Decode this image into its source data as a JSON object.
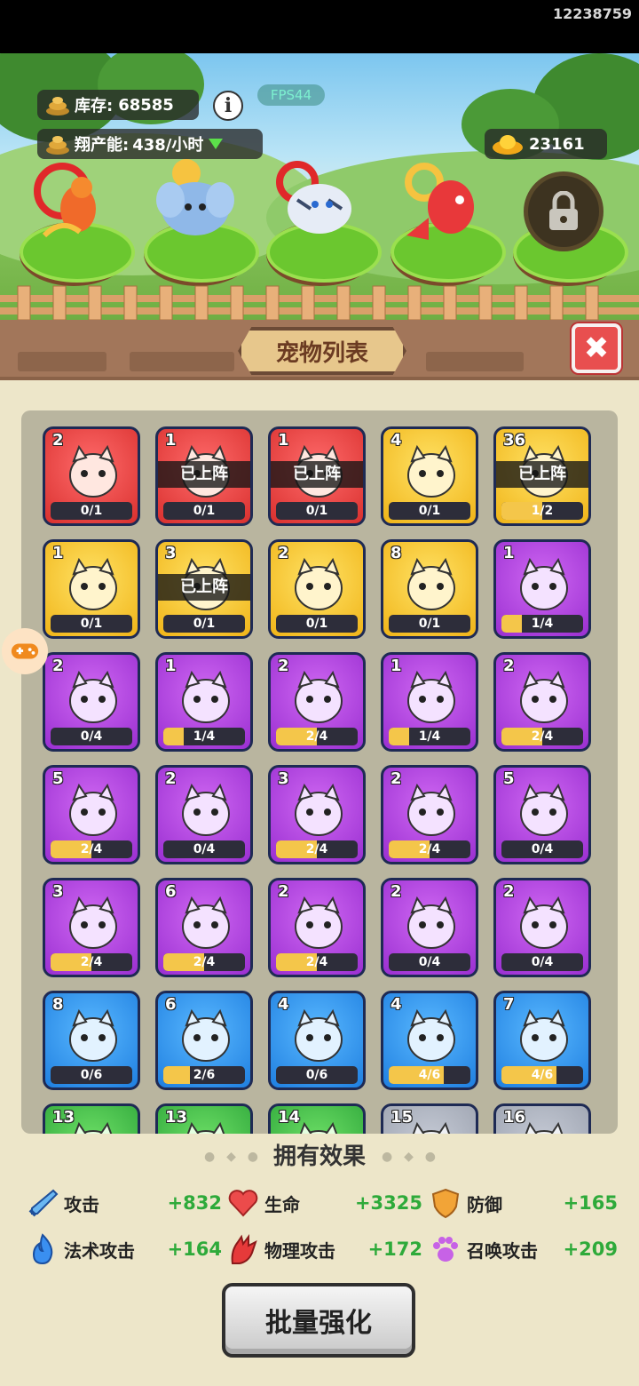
{
  "status": {
    "device_id": "12238759"
  },
  "hud": {
    "stock_label": "库存:",
    "stock_value": "68585",
    "production_label": "翔产能:",
    "production_value": "438/小时",
    "fps": "FPS44",
    "gold": "23161"
  },
  "panel": {
    "title": "宠物列表",
    "close": "✖"
  },
  "deployed_text": "已上阵",
  "pets": [
    {
      "level": "2",
      "frac": "0/1",
      "progress": 0,
      "rarity": "red",
      "deployed": false,
      "icon": "bird-icon"
    },
    {
      "level": "1",
      "frac": "0/1",
      "progress": 0,
      "rarity": "red",
      "deployed": true,
      "icon": "phoenix-icon"
    },
    {
      "level": "1",
      "frac": "0/1",
      "progress": 0,
      "rarity": "red",
      "deployed": true,
      "icon": "tiger-icon"
    },
    {
      "level": "4",
      "frac": "0/1",
      "progress": 0,
      "rarity": "yellow",
      "deployed": false,
      "icon": "fox-icon"
    },
    {
      "level": "36",
      "frac": "1/2",
      "progress": 0.5,
      "rarity": "yellow",
      "deployed": true,
      "icon": "dragon-icon"
    },
    {
      "level": "1",
      "frac": "0/1",
      "progress": 0,
      "rarity": "yellow",
      "deployed": false,
      "icon": "panda-icon"
    },
    {
      "level": "3",
      "frac": "0/1",
      "progress": 0,
      "rarity": "yellow",
      "deployed": true,
      "icon": "goldfish-icon"
    },
    {
      "level": "2",
      "frac": "0/1",
      "progress": 0,
      "rarity": "yellow",
      "deployed": false,
      "icon": "unicorn-icon"
    },
    {
      "level": "8",
      "frac": "0/1",
      "progress": 0,
      "rarity": "yellow",
      "deployed": false,
      "icon": "lion-icon"
    },
    {
      "level": "1",
      "frac": "1/4",
      "progress": 0.25,
      "rarity": "purple",
      "deployed": false,
      "icon": "frog-icon"
    },
    {
      "level": "2",
      "frac": "0/4",
      "progress": 0,
      "rarity": "purple",
      "deployed": false,
      "icon": "goat-icon"
    },
    {
      "level": "1",
      "frac": "1/4",
      "progress": 0.25,
      "rarity": "purple",
      "deployed": false,
      "icon": "monkey-icon"
    },
    {
      "level": "2",
      "frac": "2/4",
      "progress": 0.5,
      "rarity": "purple",
      "deployed": false,
      "icon": "sheep-icon"
    },
    {
      "level": "1",
      "frac": "1/4",
      "progress": 0.25,
      "rarity": "purple",
      "deployed": false,
      "icon": "leopard-icon"
    },
    {
      "level": "2",
      "frac": "2/4",
      "progress": 0.5,
      "rarity": "purple",
      "deployed": false,
      "icon": "hamster-icon"
    },
    {
      "level": "5",
      "frac": "2/4",
      "progress": 0.5,
      "rarity": "purple",
      "deployed": false,
      "icon": "octopus-icon"
    },
    {
      "level": "2",
      "frac": "0/4",
      "progress": 0,
      "rarity": "purple",
      "deployed": false,
      "icon": "wolf-icon"
    },
    {
      "level": "3",
      "frac": "2/4",
      "progress": 0.5,
      "rarity": "purple",
      "deployed": false,
      "icon": "cat-icon"
    },
    {
      "level": "2",
      "frac": "2/4",
      "progress": 0.5,
      "rarity": "purple",
      "deployed": false,
      "icon": "shiba-icon"
    },
    {
      "level": "5",
      "frac": "0/4",
      "progress": 0,
      "rarity": "purple",
      "deployed": false,
      "icon": "chicken-icon"
    },
    {
      "level": "3",
      "frac": "2/4",
      "progress": 0.5,
      "rarity": "purple",
      "deployed": false,
      "icon": "bear-icon"
    },
    {
      "level": "6",
      "frac": "2/4",
      "progress": 0.5,
      "rarity": "purple",
      "deployed": false,
      "icon": "zebra-icon"
    },
    {
      "level": "2",
      "frac": "2/4",
      "progress": 0.5,
      "rarity": "purple",
      "deployed": false,
      "icon": "red-panda-icon"
    },
    {
      "level": "2",
      "frac": "0/4",
      "progress": 0,
      "rarity": "purple",
      "deployed": false,
      "icon": "red-dragon-icon"
    },
    {
      "level": "2",
      "frac": "0/4",
      "progress": 0,
      "rarity": "purple",
      "deployed": false,
      "icon": "snow-leopard-icon"
    },
    {
      "level": "8",
      "frac": "0/6",
      "progress": 0,
      "rarity": "blue",
      "deployed": false,
      "icon": "bee-icon"
    },
    {
      "level": "6",
      "frac": "2/6",
      "progress": 0.33,
      "rarity": "blue",
      "deployed": false,
      "icon": "broom-icon"
    },
    {
      "level": "4",
      "frac": "0/6",
      "progress": 0,
      "rarity": "blue",
      "deployed": false,
      "icon": "dove-icon"
    },
    {
      "level": "4",
      "frac": "4/6",
      "progress": 0.67,
      "rarity": "blue",
      "deployed": false,
      "icon": "fishbowl-icon"
    },
    {
      "level": "7",
      "frac": "4/6",
      "progress": 0.67,
      "rarity": "blue",
      "deployed": false,
      "icon": "turtle-icon"
    },
    {
      "level": "13",
      "frac": "",
      "progress": 0,
      "rarity": "green",
      "deployed": false,
      "icon": "pet-icon"
    },
    {
      "level": "13",
      "frac": "",
      "progress": 0,
      "rarity": "green",
      "deployed": false,
      "icon": "pet-icon"
    },
    {
      "level": "14",
      "frac": "",
      "progress": 0,
      "rarity": "green",
      "deployed": false,
      "icon": "pet-icon"
    },
    {
      "level": "15",
      "frac": "",
      "progress": 0,
      "rarity": "grey",
      "deployed": false,
      "icon": "pet-icon"
    },
    {
      "level": "16",
      "frac": "",
      "progress": 0,
      "rarity": "grey",
      "deployed": false,
      "icon": "pet-icon"
    }
  ],
  "effects": {
    "title": "拥有效果",
    "items": [
      {
        "name": "攻击",
        "value": "+832",
        "icon": "sword-icon"
      },
      {
        "name": "生命",
        "value": "+3325",
        "icon": "heart-icon"
      },
      {
        "name": "防御",
        "value": "+165",
        "icon": "shield-icon"
      },
      {
        "name": "法术攻击",
        "value": "+164",
        "icon": "flame-icon"
      },
      {
        "name": "物理攻击",
        "value": "+172",
        "icon": "claw-icon"
      },
      {
        "name": "召唤攻击",
        "value": "+209",
        "icon": "paw-icon"
      }
    ]
  },
  "batch_button": "批量强化",
  "colors": {
    "red": "#d9302e",
    "yellow": "#f0b418",
    "purple": "#9a2fd1",
    "blue": "#1f7fe0",
    "green": "#2ea63a",
    "effect_value": "#2eaa3a"
  }
}
